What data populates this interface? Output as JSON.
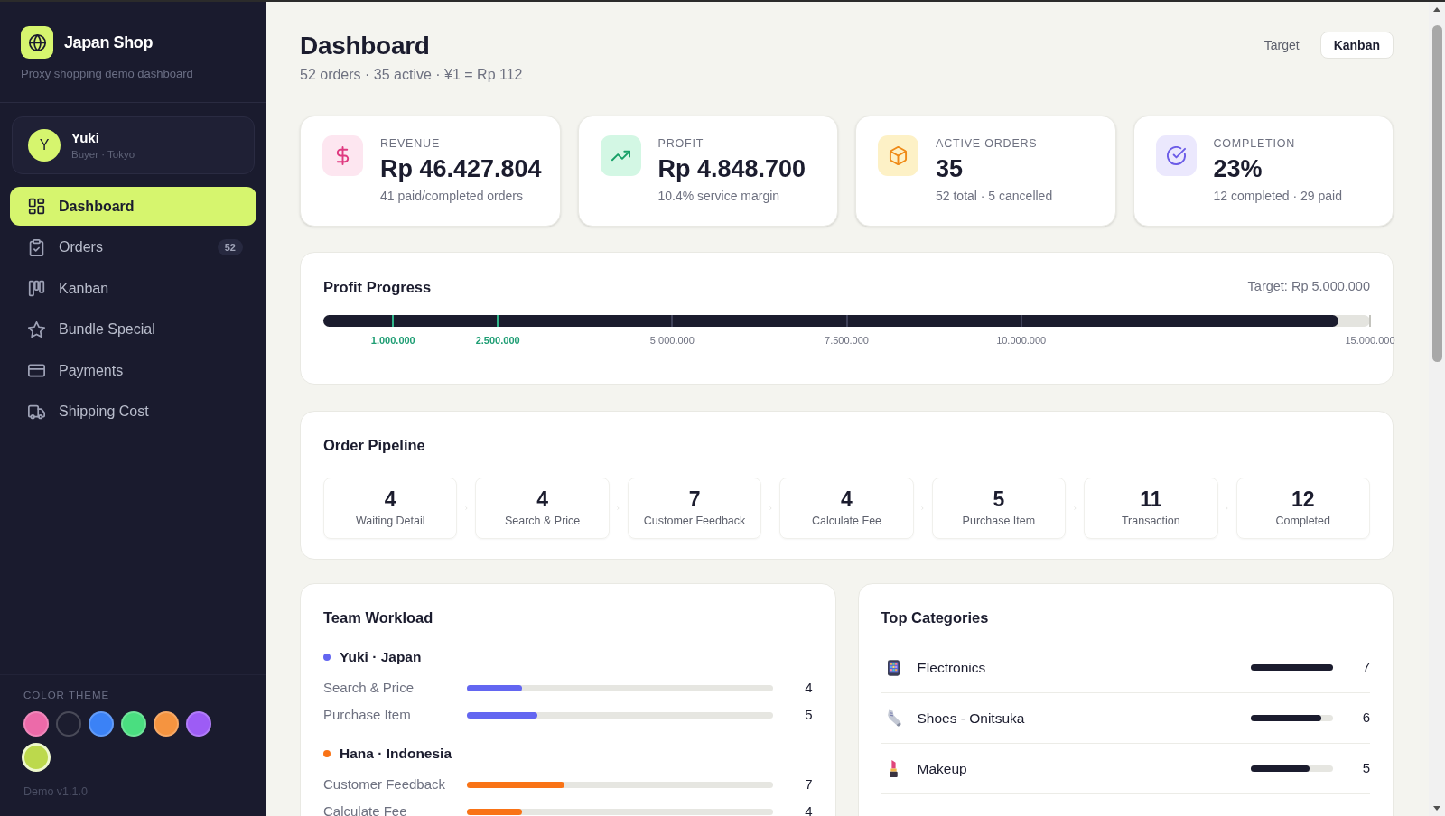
{
  "sidebar": {
    "brand": {
      "title": "Japan Shop",
      "subtitle": "Proxy shopping demo dashboard"
    },
    "user": {
      "initial": "Y",
      "name": "Yuki",
      "role": "Buyer · Tokyo"
    },
    "nav": [
      {
        "label": "Dashboard",
        "kind": "grid",
        "selected": true
      },
      {
        "label": "Orders",
        "kind": "clipboard",
        "selected": false,
        "badge": "52"
      },
      {
        "label": "Kanban",
        "kind": "columns",
        "selected": false
      },
      {
        "label": "Bundle Special",
        "kind": "star",
        "selected": false
      },
      {
        "label": "Payments",
        "kind": "card",
        "selected": false
      },
      {
        "label": "Shipping Cost",
        "kind": "truck",
        "selected": false
      }
    ],
    "theme": {
      "label": "COLOR THEME",
      "swatches": [
        {
          "color": "#ec6aa9",
          "selected": false
        },
        {
          "color": "#1c1d2f",
          "selected": false
        },
        {
          "color": "#3b82f6",
          "selected": false
        },
        {
          "color": "#4ade80",
          "selected": false
        },
        {
          "color": "#f59440",
          "selected": false
        },
        {
          "color": "#9d5cf5",
          "selected": false
        },
        {
          "color": "#bcd94c",
          "selected": true
        }
      ]
    },
    "version": "Demo v1.1.0"
  },
  "header": {
    "title": "Dashboard",
    "subtitle": "52 orders · 35 active · ¥1 = Rp 112",
    "actions": [
      {
        "label": "Target",
        "kind": "ghost"
      },
      {
        "label": "Kanban",
        "kind": "outline"
      }
    ]
  },
  "stats": [
    {
      "kind": "money",
      "label": "REVENUE",
      "value": "Rp 46.427.804",
      "note": "41 paid/completed orders"
    },
    {
      "kind": "trend",
      "label": "PROFIT",
      "value": "Rp 4.848.700",
      "note": "10.4% service margin"
    },
    {
      "kind": "box",
      "label": "ACTIVE ORDERS",
      "value": "35",
      "note": "52 total · 5 cancelled"
    },
    {
      "kind": "check",
      "label": "COMPLETION",
      "value": "23%",
      "note": "12 completed · 29 paid"
    }
  ],
  "profit_progress": {
    "title": "Profit Progress",
    "target": "Target: Rp 5.000.000",
    "level": 0.97,
    "milestones": [
      {
        "label": "1.000.000",
        "reached": true
      },
      {
        "label": "2.500.000",
        "reached": true
      },
      {
        "label": "5.000.000",
        "reached": false
      },
      {
        "label": "7.500.000",
        "reached": false
      },
      {
        "label": "10.000.000",
        "reached": false
      },
      {
        "label": "15.000.000",
        "reached": false
      }
    ]
  },
  "order_pipeline": {
    "title": "Order Pipeline",
    "stages": [
      {
        "count": "4",
        "label": "Waiting Detail"
      },
      {
        "count": "4",
        "label": "Search & Price"
      },
      {
        "count": "7",
        "label": "Customer Feedback"
      },
      {
        "count": "4",
        "label": "Calculate Fee"
      },
      {
        "count": "5",
        "label": "Purchase Item"
      },
      {
        "count": "11",
        "label": "Transaction"
      },
      {
        "count": "12",
        "label": "Completed"
      }
    ]
  },
  "team_workload": {
    "title": "Team Workload",
    "members": [
      {
        "name": "Yuki · Japan",
        "color": "#6366f1",
        "tasks": [
          {
            "label": "Search & Price",
            "level": 0.18,
            "count": "4"
          },
          {
            "label": "Purchase Item",
            "level": 0.23,
            "count": "5"
          }
        ]
      },
      {
        "name": "Hana · Indonesia",
        "color": "#f97316",
        "tasks": [
          {
            "label": "Customer Feedback",
            "level": 0.32,
            "count": "7"
          },
          {
            "label": "Calculate Fee",
            "level": 0.18,
            "count": "4"
          }
        ]
      }
    ]
  },
  "top_categories": {
    "title": "Top Categories",
    "rows": [
      {
        "kind": "phone",
        "label": "Electronics",
        "level": 1,
        "count": "7"
      },
      {
        "kind": "sneaker",
        "label": "Shoes - Onitsuka",
        "level": 0.86,
        "count": "6"
      },
      {
        "kind": "lipstick",
        "label": "Makeup",
        "level": 0.71,
        "count": "5"
      }
    ]
  }
}
